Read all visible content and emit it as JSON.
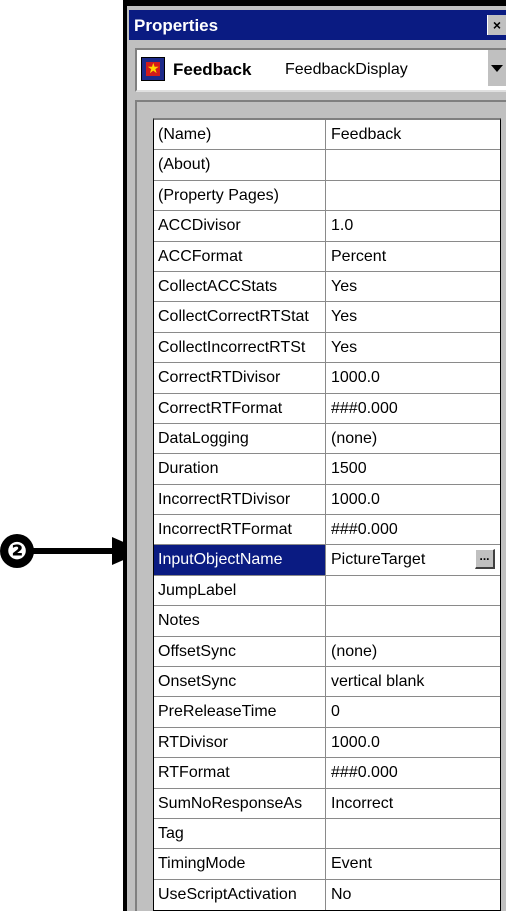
{
  "window": {
    "title": "Properties",
    "close_glyph": "×"
  },
  "object_selector": {
    "name": "Feedback",
    "type": "FeedbackDisplay",
    "icon": "feedback-object-icon"
  },
  "callout": {
    "number": "❷"
  },
  "properties": [
    {
      "name": "(Name)",
      "value": "Feedback"
    },
    {
      "name": "(About)",
      "value": ""
    },
    {
      "name": "(Property Pages)",
      "value": ""
    },
    {
      "name": "ACCDivisor",
      "value": "1.0"
    },
    {
      "name": "ACCFormat",
      "value": "Percent"
    },
    {
      "name": "CollectACCStats",
      "value": "Yes"
    },
    {
      "name": "CollectCorrectRTStat",
      "value": "Yes"
    },
    {
      "name": "CollectIncorrectRTSt",
      "value": "Yes"
    },
    {
      "name": "CorrectRTDivisor",
      "value": "1000.0"
    },
    {
      "name": "CorrectRTFormat",
      "value": "###0.000"
    },
    {
      "name": "DataLogging",
      "value": "(none)"
    },
    {
      "name": "Duration",
      "value": "1500"
    },
    {
      "name": "IncorrectRTDivisor",
      "value": "1000.0"
    },
    {
      "name": "IncorrectRTFormat",
      "value": "###0.000"
    },
    {
      "name": "InputObjectName",
      "value": "PictureTarget",
      "selected": true,
      "button": "..."
    },
    {
      "name": "JumpLabel",
      "value": ""
    },
    {
      "name": "Notes",
      "value": ""
    },
    {
      "name": "OffsetSync",
      "value": "(none)"
    },
    {
      "name": "OnsetSync",
      "value": "vertical blank"
    },
    {
      "name": "PreReleaseTime",
      "value": "0"
    },
    {
      "name": "RTDivisor",
      "value": "1000.0"
    },
    {
      "name": "RTFormat",
      "value": "###0.000"
    },
    {
      "name": "SumNoResponseAs",
      "value": "Incorrect"
    },
    {
      "name": "Tag",
      "value": ""
    },
    {
      "name": "TimingMode",
      "value": "Event"
    },
    {
      "name": "UseScriptActivation",
      "value": "No"
    }
  ],
  "colors": {
    "titlebar": "#0a1b82",
    "selected_row": "#0a1b82",
    "face": "#c0c0c0"
  }
}
